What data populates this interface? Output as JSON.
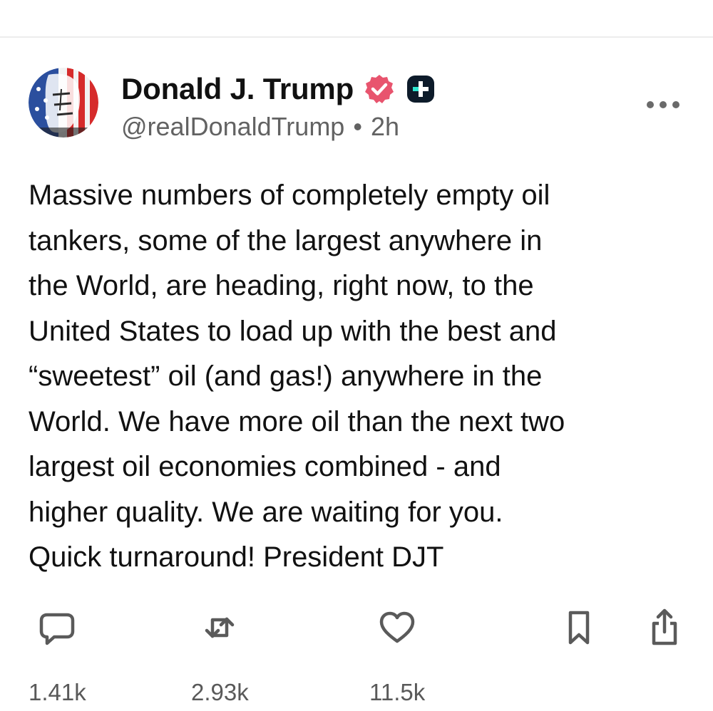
{
  "post": {
    "author": {
      "display_name": "Donald J. Trump",
      "handle": "@realDonaldTrump",
      "separator": "•",
      "time": "2h",
      "verified_badge_icon": "verified-badge-icon",
      "plus_badge_icon": "plus-badge-icon"
    },
    "text": "Massive numbers of completely empty oil\ntankers, some of the largest anywhere in\nthe World, are heading, right now, to the\nUnited States to load up with the best and\n“sweetest” oil (and gas!) anywhere in the\nWorld. We have more oil than the next two\nlargest oil economies combined - and\nhigher quality. We are waiting for you.\nQuick turnaround! President DJT",
    "actions": {
      "reply": {
        "icon": "comment-icon",
        "count": "1.41k"
      },
      "repost": {
        "icon": "repost-icon",
        "count": "2.93k"
      },
      "like": {
        "icon": "heart-icon",
        "count": "11.5k"
      },
      "bookmark": {
        "icon": "bookmark-icon"
      },
      "share": {
        "icon": "share-icon"
      }
    }
  },
  "colors": {
    "verified_badge": "#e8546e",
    "plus_badge": "#0d1b2a",
    "plus_badge_accent": "#2ee6d0",
    "text_primary": "#111111",
    "text_secondary": "#626262",
    "icon": "#5a5a5a"
  }
}
